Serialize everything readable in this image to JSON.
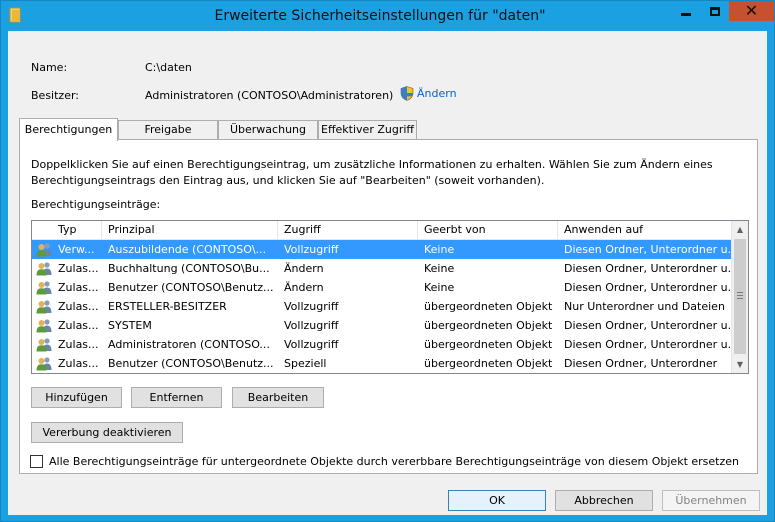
{
  "window": {
    "title": "Erweiterte Sicherheitseinstellungen für \"daten\"",
    "accent_color": "#1ba1e2",
    "close_color": "#c7502e"
  },
  "info": {
    "name_label": "Name:",
    "name_value": "C:\\daten",
    "owner_label": "Besitzer:",
    "owner_value": "Administratoren (CONTOSO\\Administratoren)",
    "change_link": "Ändern"
  },
  "tabs": [
    {
      "label": "Berechtigungen",
      "active": true
    },
    {
      "label": "Freigabe",
      "active": false
    },
    {
      "label": "Überwachung",
      "active": false
    },
    {
      "label": "Effektiver Zugriff",
      "active": false
    }
  ],
  "permissions": {
    "description": "Doppelklicken Sie auf einen Berechtigungseintrag, um zusätzliche Informationen zu erhalten. Wählen Sie zum Ändern eines Berechtigungseintrags den Eintrag aus, und klicken Sie auf \"Bearbeiten\" (soweit vorhanden).",
    "entries_label": "Berechtigungseinträge:",
    "columns": [
      "Typ",
      "Prinzipal",
      "Zugriff",
      "Geerbt von",
      "Anwenden auf"
    ],
    "rows": [
      {
        "icon": "user-group-icon",
        "type": "Verw...",
        "principal": "Auszubildende (CONTOSO\\...",
        "access": "Vollzugriff",
        "inherited": "Keine",
        "applies": "Diesen Ordner, Unterordner u...",
        "selected": true
      },
      {
        "icon": "user-group-icon",
        "type": "Zulas...",
        "principal": "Buchhaltung (CONTOSO\\Bu...",
        "access": "Ändern",
        "inherited": "Keine",
        "applies": "Diesen Ordner, Unterordner u...",
        "selected": false
      },
      {
        "icon": "user-group-icon",
        "type": "Zulas...",
        "principal": "Benutzer (CONTOSO\\Benutz...",
        "access": "Ändern",
        "inherited": "Keine",
        "applies": "Diesen Ordner, Unterordner u...",
        "selected": false
      },
      {
        "icon": "user-group-icon",
        "type": "Zulas...",
        "principal": "ERSTELLER-BESITZER",
        "access": "Vollzugriff",
        "inherited": "übergeordneten Objekt",
        "applies": "Nur Unterordner und Dateien",
        "selected": false
      },
      {
        "icon": "user-group-icon",
        "type": "Zulas...",
        "principal": "SYSTEM",
        "access": "Vollzugriff",
        "inherited": "übergeordneten Objekt",
        "applies": "Diesen Ordner, Unterordner u...",
        "selected": false
      },
      {
        "icon": "user-group-icon",
        "type": "Zulas...",
        "principal": "Administratoren (CONTOSO...",
        "access": "Vollzugriff",
        "inherited": "übergeordneten Objekt",
        "applies": "Diesen Ordner, Unterordner u...",
        "selected": false
      },
      {
        "icon": "user-group-icon",
        "type": "Zulas...",
        "principal": "Benutzer (CONTOSO\\Benutz...",
        "access": "Speziell",
        "inherited": "übergeordneten Objekt",
        "applies": "Diesen Ordner, Unterordner",
        "selected": false
      }
    ],
    "add_button": "Hinzufügen",
    "remove_button": "Entfernen",
    "edit_button": "Bearbeiten",
    "disable_inheritance_button": "Vererbung deaktivieren",
    "replace_checkbox_label": "Alle Berechtigungseinträge für untergeordnete Objekte durch vererbbare Berechtigungseinträge von diesem Objekt ersetzen",
    "replace_checked": false
  },
  "footer": {
    "ok": "OK",
    "cancel": "Abbrechen",
    "apply": "Übernehmen"
  }
}
